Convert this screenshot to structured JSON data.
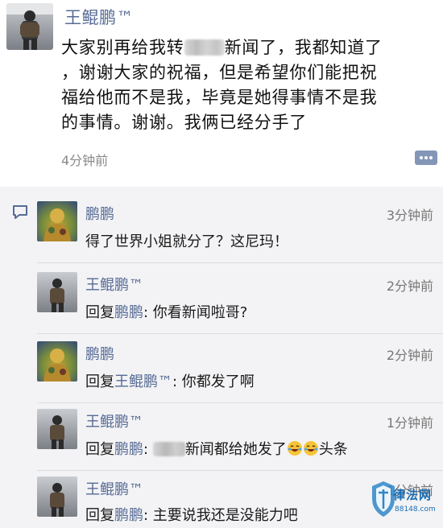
{
  "post": {
    "author": "王鲲鹏™",
    "text_line1_a": "大家别再给我转",
    "text_line1_b": "新闻了，我都知道了",
    "text_line2": "，谢谢大家的祝福，但是希望你们能把祝",
    "text_line3": "福给他而不是我，毕竟是她得事情不是我",
    "text_line4": "的事情。谢谢。我俩已经分手了",
    "time": "4分钟前"
  },
  "comments": [
    {
      "author": "鹏鹏",
      "time": "3分钟前",
      "text": "得了世界小姐就分了？这尼玛！",
      "avatar": "tattoo"
    },
    {
      "author": "王鲲鹏™",
      "time": "2分钟前",
      "reply_prefix": "回复",
      "reply_to": "鹏鹏",
      "text": ": 你看新闻啦哥?",
      "avatar": "backpack"
    },
    {
      "author": "鹏鹏",
      "time": "2分钟前",
      "reply_prefix": "回复",
      "reply_to": "王鲲鹏™",
      "text": ": 你都发了啊",
      "avatar": "tattoo"
    },
    {
      "author": "王鲲鹏™",
      "time": "1分钟前",
      "reply_prefix": "回复",
      "reply_to": "鹏鹏",
      "text_after": "新闻都给她发了",
      "text_end": "头条",
      "text_colon": ":",
      "avatar": "backpack"
    },
    {
      "author": "王鲲鹏™",
      "time": "1分钟前",
      "reply_prefix": "回复",
      "reply_to": "鹏鹏",
      "text": ": 主要说我还是没能力吧",
      "avatar": "backpack"
    }
  ],
  "watermark": {
    "text": "律法网",
    "url": "88148.com"
  },
  "colors": {
    "name_link": "#576b95",
    "comment_bg": "#f3f3f5",
    "watermark": "#1a6fb5"
  },
  "icons": [
    "comment-icon",
    "more-icon",
    "laughing-crying-emoji"
  ]
}
